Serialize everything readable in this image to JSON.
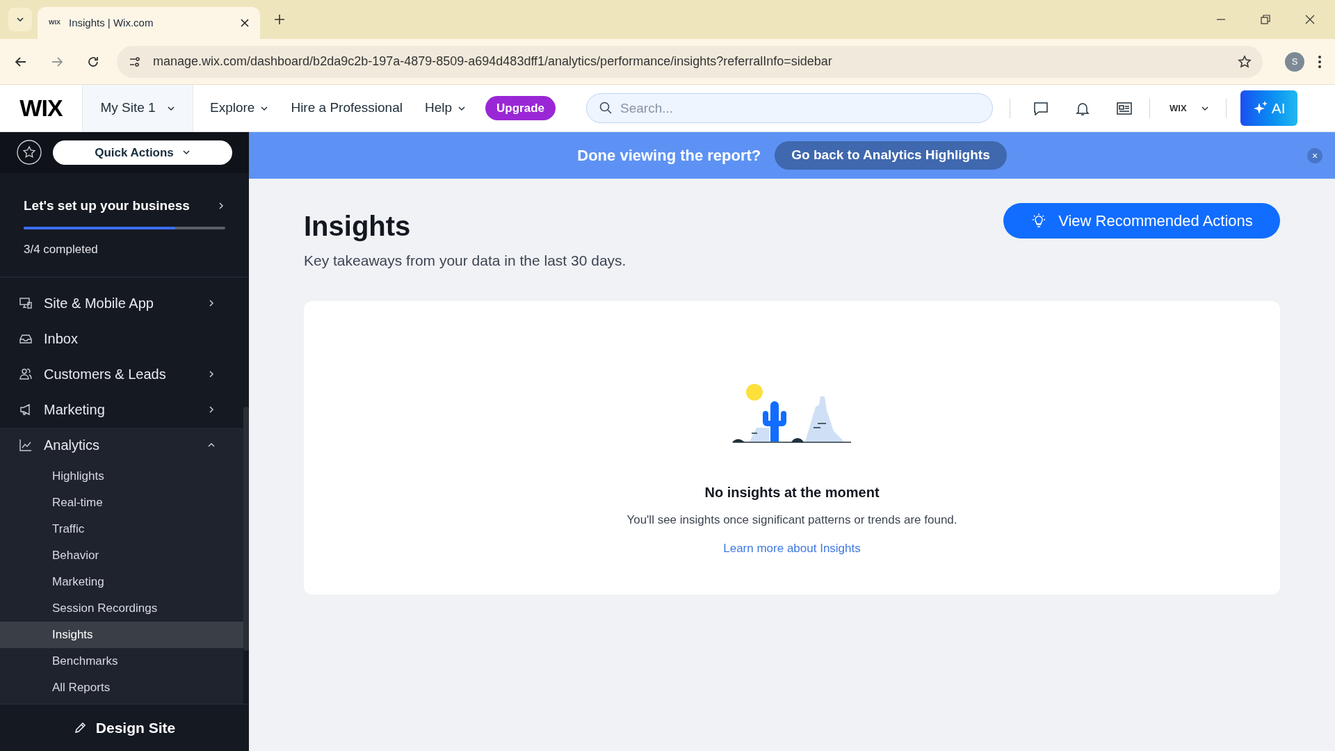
{
  "browser": {
    "tab_title": "Insights | Wix.com",
    "tab_favicon": "WIX",
    "url": "manage.wix.com/dashboard/b2da9c2b-197a-4879-8509-a694d483dff1/analytics/performance/insights?referralInfo=sidebar",
    "profile_initial": "S"
  },
  "header": {
    "logo": "WIX",
    "site": "My Site 1",
    "nav": [
      {
        "label": "Explore",
        "dropdown": true
      },
      {
        "label": "Hire a Professional",
        "dropdown": false
      },
      {
        "label": "Help",
        "dropdown": true
      }
    ],
    "upgrade": "Upgrade",
    "search": {
      "placeholder": "Search..."
    },
    "account": "WIX",
    "ai": "AI"
  },
  "sidebar": {
    "quick_actions": "Quick Actions",
    "setup": {
      "title": "Let's set up your business",
      "level": 0.75,
      "progress": "3/4 completed"
    },
    "items": [
      {
        "label": "Site & Mobile App",
        "kind": "menu",
        "expanded": false
      },
      {
        "label": "Inbox",
        "kind": "link",
        "expanded": false
      },
      {
        "label": "Customers & Leads",
        "kind": "menu",
        "expanded": false
      },
      {
        "label": "Marketing",
        "kind": "menu",
        "expanded": false
      },
      {
        "label": "Analytics",
        "kind": "menu",
        "expanded": true,
        "children": [
          {
            "label": "Highlights",
            "selected": false
          },
          {
            "label": "Real-time",
            "selected": false
          },
          {
            "label": "Traffic",
            "selected": false
          },
          {
            "label": "Behavior",
            "selected": false
          },
          {
            "label": "Marketing",
            "selected": false
          },
          {
            "label": "Session Recordings",
            "selected": false
          },
          {
            "label": "Insights",
            "selected": true
          },
          {
            "label": "Benchmarks",
            "selected": false
          },
          {
            "label": "All Reports",
            "selected": false
          }
        ]
      }
    ],
    "design_site": "Design Site"
  },
  "banner": {
    "text": "Done viewing the report?",
    "button": "Go back to Analytics Highlights",
    "close": "×"
  },
  "main": {
    "title": "Insights",
    "subtitle": "Key takeaways from your data in the last 30 days.",
    "action_button": "View Recommended Actions",
    "empty_state": {
      "title": "No insights at the moment",
      "text": "You'll see insights once significant patterns or trends are found.",
      "link": "Learn more about Insights"
    }
  }
}
